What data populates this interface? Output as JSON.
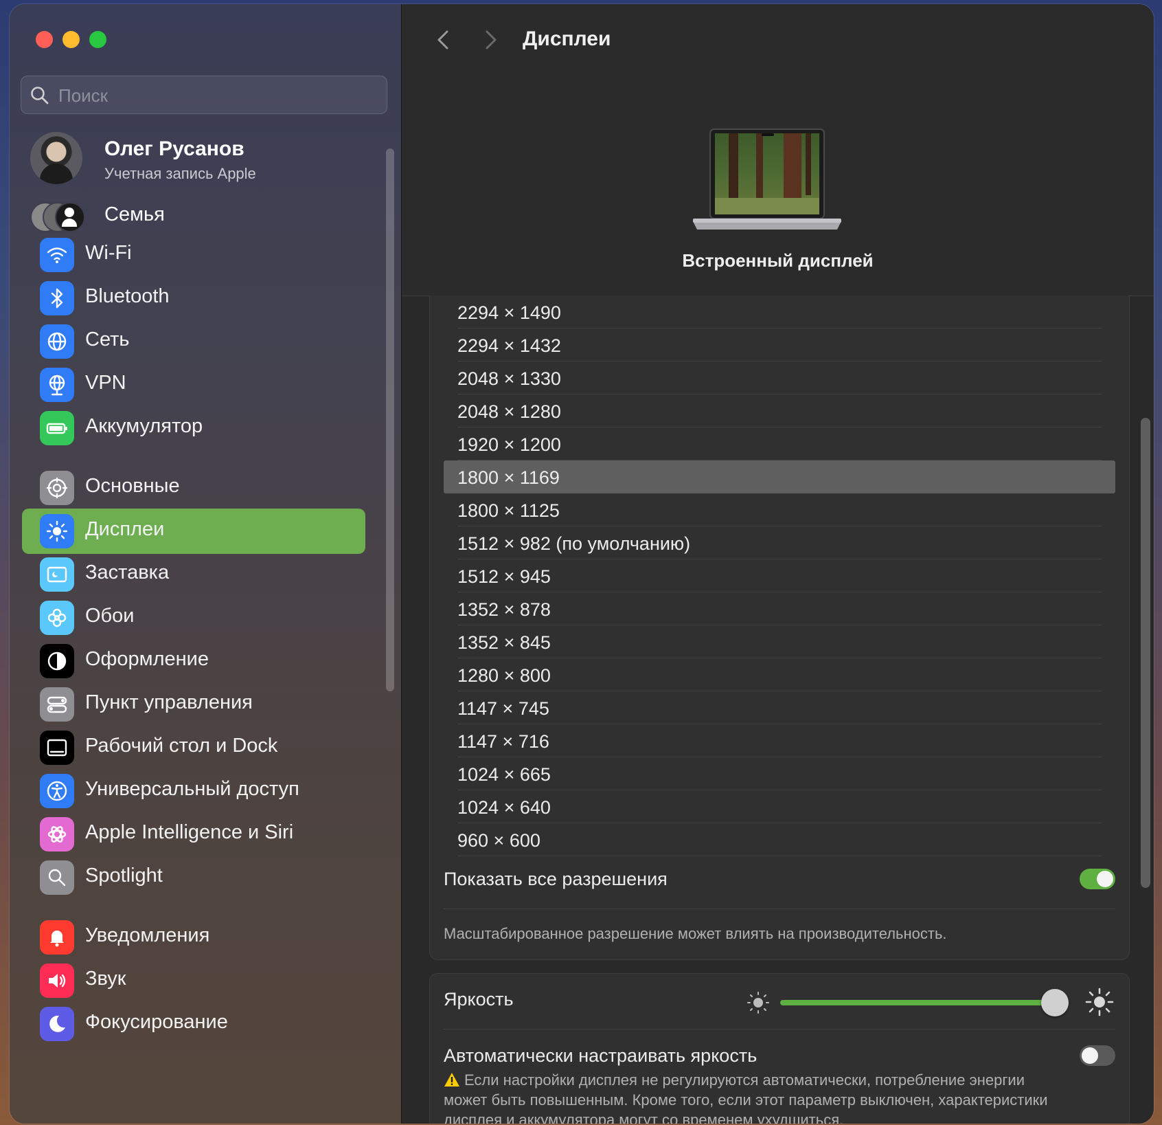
{
  "window": {
    "title": "Дисплеи"
  },
  "search": {
    "placeholder": "Поиск"
  },
  "profile": {
    "name": "Олег Русанов",
    "subtitle": "Учетная запись Apple"
  },
  "family": {
    "label": "Семья"
  },
  "sidebar": {
    "items": [
      {
        "label": "Wi-Fi",
        "icon": "wifi-icon",
        "color": "#2f7cf6"
      },
      {
        "label": "Bluetooth",
        "icon": "bluetooth-icon",
        "color": "#2f7cf6"
      },
      {
        "label": "Сеть",
        "icon": "globe-icon",
        "color": "#2f7cf6"
      },
      {
        "label": "VPN",
        "icon": "vpn-globe-icon",
        "color": "#2f7cf6"
      },
      {
        "label": "Аккумулятор",
        "icon": "battery-icon",
        "color": "#34c759"
      },
      {
        "label": "Основные",
        "icon": "gear-icon",
        "color": "#8e8e93"
      },
      {
        "label": "Дисплеи",
        "icon": "brightness-icon",
        "color": "#2f7cf6",
        "selected": true
      },
      {
        "label": "Заставка",
        "icon": "screensaver-icon",
        "color": "#5ac8fa"
      },
      {
        "label": "Обои",
        "icon": "flower-icon",
        "color": "#5ac8fa"
      },
      {
        "label": "Оформление",
        "icon": "appearance-icon",
        "color": "#000000"
      },
      {
        "label": "Пункт управления",
        "icon": "control-center-icon",
        "color": "#8e8e93"
      },
      {
        "label": "Рабочий стол и Dock",
        "icon": "dock-icon",
        "color": "#000000"
      },
      {
        "label": "Универсальный доступ",
        "icon": "accessibility-icon",
        "color": "#2f7cf6"
      },
      {
        "label": "Apple Intelligence и Siri",
        "icon": "siri-icon",
        "color": "#e26ad0"
      },
      {
        "label": "Spotlight",
        "icon": "magnifier-icon",
        "color": "#8e8e93"
      },
      {
        "label": "Уведомления",
        "icon": "bell-icon",
        "color": "#ff3b30"
      },
      {
        "label": "Звук",
        "icon": "speaker-icon",
        "color": "#ff2d55"
      },
      {
        "label": "Фокусирование",
        "icon": "moon-icon",
        "color": "#5e5ce6"
      }
    ]
  },
  "display": {
    "name": "Встроенный дисплей"
  },
  "resolutions": [
    {
      "label": "2294 × 1490"
    },
    {
      "label": "2294 × 1432"
    },
    {
      "label": "2048 × 1330"
    },
    {
      "label": "2048 × 1280"
    },
    {
      "label": "1920 × 1200"
    },
    {
      "label": "1800 × 1169",
      "selected": true
    },
    {
      "label": "1800 × 1125"
    },
    {
      "label": "1512 × 982 (по умолчанию)"
    },
    {
      "label": "1512 × 945"
    },
    {
      "label": "1352 × 878"
    },
    {
      "label": "1352 × 845"
    },
    {
      "label": "1280 × 800"
    },
    {
      "label": "1147 × 745"
    },
    {
      "label": "1147 × 716"
    },
    {
      "label": "1024 × 665"
    },
    {
      "label": "1024 × 640"
    },
    {
      "label": "960 × 600"
    }
  ],
  "show_all": {
    "label": "Показать все разрешения",
    "on": true
  },
  "scaled_note": "Масштабированное разрешение может влиять на производительность.",
  "brightness": {
    "label": "Яркость",
    "level": 0.95
  },
  "auto_brightness": {
    "label": "Автоматически настраивать яркость",
    "on": false,
    "warning": "Если настройки дисплея не регулируются автоматически, потребление энергии может быть повышенным. Кроме того, если этот параметр выключен, характеристики дисплея и аккумулятора могут со временем ухудшиться."
  },
  "colors": {
    "accent": "#6ead50",
    "toggle_on": "#5eb041"
  }
}
